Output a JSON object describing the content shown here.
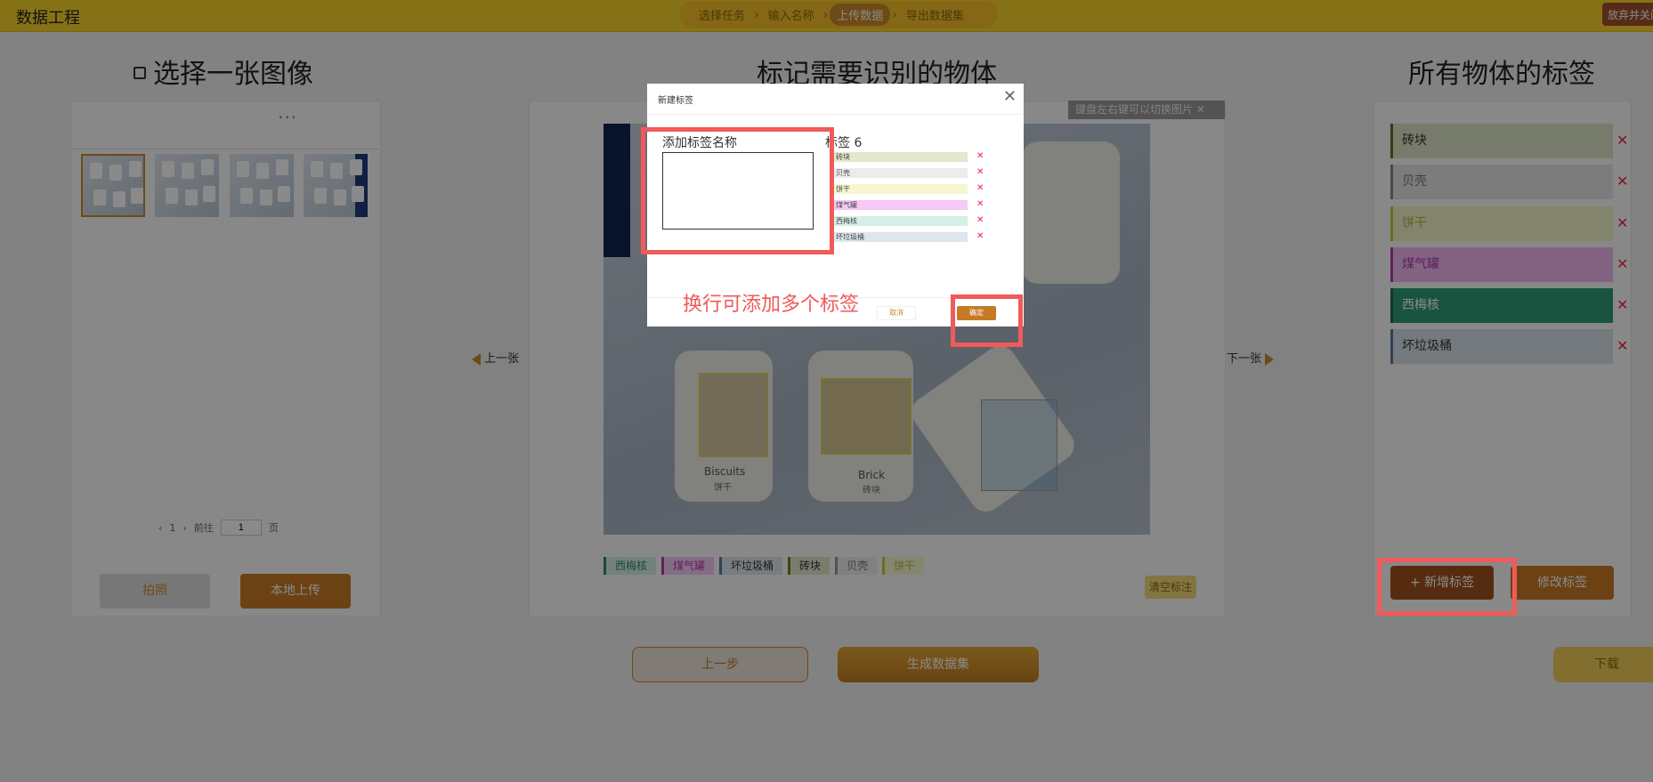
{
  "app": {
    "title": "数据工程",
    "discard": "放弃并关闭"
  },
  "steps": [
    "选择任务",
    "输入名称",
    "上传数据",
    "导出数据集"
  ],
  "left_panel": {
    "heading": "选择一张图像",
    "pager": {
      "prev": "‹",
      "page": "1",
      "next": "›",
      "goto": "前往",
      "input": "1",
      "page_unit": "页"
    },
    "photo_button": "拍照",
    "upload_button": "本地上传"
  },
  "center_panel": {
    "heading": "标记需要识别的物体",
    "hint": "键盘左右键可以切换图片 ✕",
    "prev": "上一张",
    "next": "下一张",
    "card_biscuits_en": "Biscuits",
    "card_biscuits_cn": "饼干",
    "card_brick_en": "Brick",
    "card_brick_cn": "砖块",
    "chips": [
      {
        "label": "西梅核",
        "color": "#2e8b6b"
      },
      {
        "label": "煤气罐",
        "color": "#b03ab0"
      },
      {
        "label": "坏垃圾桶",
        "color": "#5a7a99"
      },
      {
        "label": "砖块",
        "color": "#7a7a2a"
      },
      {
        "label": "贝壳",
        "color": "#999999"
      },
      {
        "label": "饼干",
        "color": "#c8c840"
      }
    ],
    "clear_button": "清空标注"
  },
  "right_panel": {
    "heading": "所有物体的标签",
    "labels": [
      {
        "label": "砖块",
        "bg": "#dde3c8",
        "border": "#6b6b1a"
      },
      {
        "label": "贝壳",
        "bg": "#e6e6e6",
        "border": "#888888"
      },
      {
        "label": "饼干",
        "bg": "#f2f4c8",
        "border": "#c8c840"
      },
      {
        "label": "煤气罐",
        "bg": "#f0b8f0",
        "border": "#b03ab0"
      },
      {
        "label": "西梅核",
        "bg": "#2e9b76",
        "border": "#1e6b52"
      },
      {
        "label": "坏垃圾桶",
        "bg": "#d5dfe8",
        "border": "#5a7a99"
      }
    ],
    "remove": "✕",
    "add_button": "+ 新增标签",
    "edit_button": "修改标签"
  },
  "footer": {
    "prev_step": "上一步",
    "generate": "生成数据集",
    "download": "下载"
  },
  "dialog": {
    "title": "新建标签",
    "close": "✕",
    "add_title": "添加标签名称",
    "count_label": "标签 6",
    "tags": [
      {
        "label": "砖块",
        "bg": "#e1e8cc"
      },
      {
        "label": "贝壳",
        "bg": "#ececec"
      },
      {
        "label": "饼干",
        "bg": "#f6f7d0"
      },
      {
        "label": "煤气罐",
        "bg": "#f6c8f6"
      },
      {
        "label": "西梅核",
        "bg": "#d6efe6"
      },
      {
        "label": "坏垃圾桶",
        "bg": "#dde6ee"
      }
    ],
    "remove": "✕",
    "cancel": "取消",
    "ok": "确定"
  },
  "annotation": "换行可添加多个标签"
}
